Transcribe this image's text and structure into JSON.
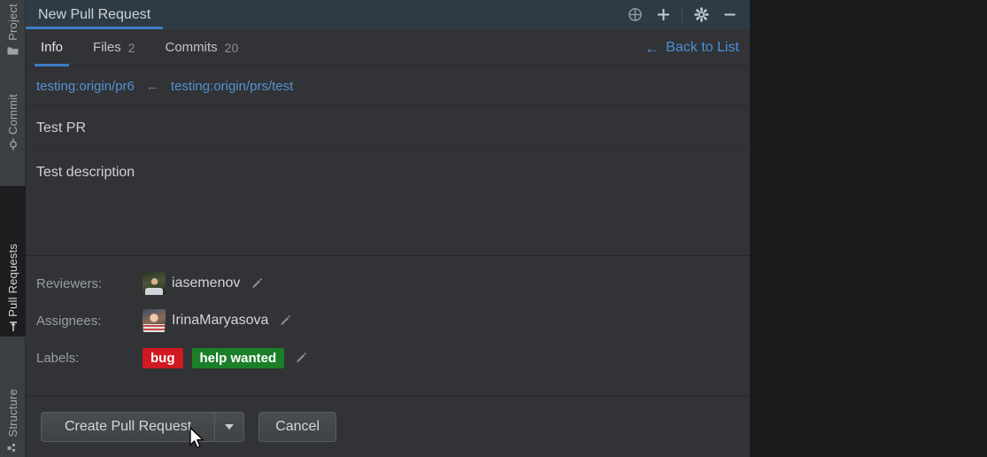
{
  "sidebar": {
    "tabs": [
      {
        "label": "Project",
        "icon": "folder-icon",
        "active": false
      },
      {
        "label": "Commit",
        "icon": "commit-icon",
        "active": false
      },
      {
        "label": "Pull Requests",
        "icon": "pull-request-icon",
        "active": true
      },
      {
        "label": "Structure",
        "icon": "structure-icon",
        "active": false
      }
    ]
  },
  "window": {
    "tab_title": "New Pull Request",
    "actions": [
      {
        "name": "target-icon",
        "glyph": "target"
      },
      {
        "name": "add-icon",
        "glyph": "plus"
      },
      {
        "name": "settings-icon",
        "glyph": "gear"
      },
      {
        "name": "minimize-icon",
        "glyph": "minus"
      }
    ]
  },
  "tabs": [
    {
      "label": "Info",
      "count": "",
      "active": true
    },
    {
      "label": "Files",
      "count": "2",
      "active": false
    },
    {
      "label": "Commits",
      "count": "20",
      "active": false
    }
  ],
  "back_link": {
    "arrow": "←",
    "label": "Back to List"
  },
  "branches": {
    "target": "testing:origin/pr6",
    "arrow": "←",
    "source": "testing:origin/prs/test"
  },
  "pull_request": {
    "title": "Test PR",
    "description": "Test description"
  },
  "metadata": {
    "reviewers_label": "Reviewers:",
    "reviewers_value": "iasemenov",
    "assignees_label": "Assignees:",
    "assignees_value": "IrinaMaryasova",
    "labels_label": "Labels:",
    "labels": [
      {
        "text": "bug",
        "color": "#d01921"
      },
      {
        "text": "help wanted",
        "color": "#1a7f28"
      }
    ]
  },
  "actions": {
    "create_label": "Create Pull Request",
    "cancel_label": "Cancel"
  },
  "colors": {
    "accent_blue": "#3d7dc4",
    "link_blue": "#4a90d9",
    "branch_blue": "#5791cf",
    "panel_bg": "#313336",
    "titlebar_bg": "#2f3b44",
    "sidebar_bg": "#3c3f41",
    "desktop_bg": "#1b1b1d"
  }
}
